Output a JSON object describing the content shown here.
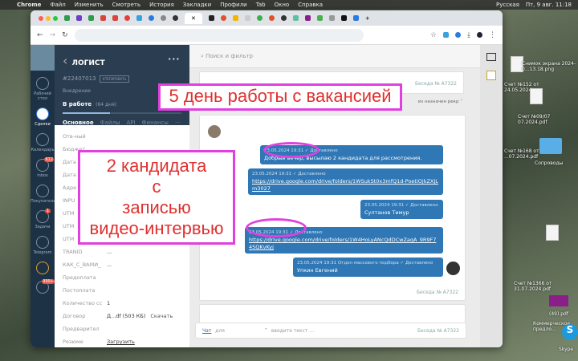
{
  "menubar": {
    "app": "Chrome",
    "items": [
      "Файл",
      "Изменить",
      "Смотреть",
      "История",
      "Закладки",
      "Профили",
      "Tab",
      "Окно",
      "Справка"
    ],
    "input_source": "Русская",
    "datetime": "Пт, 9 авг. 11:18"
  },
  "rail": {
    "items": [
      "Рабочий стол",
      "Сделки",
      "Календарь",
      "inbox",
      "Покупатели",
      "Задачи",
      "Telegram"
    ],
    "inbox_badge": "612",
    "tasks_badge": "1",
    "bell_badge": "999+"
  },
  "lead": {
    "title": "ЛОГИСТ",
    "id": "#22407013",
    "copy": "#ТЕГИРОВАТЬ",
    "stage_label": "Внедрение",
    "stage": "В работе",
    "stage_days": "(64 дня)",
    "progress": 0.4,
    "tabs": [
      "Основное",
      "Файлы",
      "API",
      "Финансы",
      "···"
    ],
    "fields": [
      {
        "k": "Отв-ный",
        "v": ""
      },
      {
        "k": "Бюджет",
        "v": ""
      },
      {
        "k": "Дата",
        "v": ""
      },
      {
        "k": "Дата",
        "v": ""
      },
      {
        "k": "Адре",
        "v": ""
      },
      {
        "k": "INPU",
        "v": ""
      },
      {
        "k": "UTM",
        "v": ""
      },
      {
        "k": "UTM",
        "v": ""
      },
      {
        "k": "UTM",
        "v": ""
      },
      {
        "k": "TRANID",
        "v": "..."
      },
      {
        "k": "КАК_С_ВАМИ_",
        "v": "..."
      },
      {
        "k": "Предоплата",
        "v": ""
      },
      {
        "k": "Постоплата",
        "v": ""
      },
      {
        "k": "Количество сс",
        "v": "1"
      },
      {
        "k": "Договор",
        "v": "Д...df (503 КБ)",
        "action": "Скачать"
      },
      {
        "k": "Предварител",
        "v": ""
      },
      {
        "k": "Резюме",
        "v": "Загрузить"
      }
    ]
  },
  "main": {
    "search_placeholder": "Поиск и фильтр",
    "conversation": "Беседа № A7322",
    "assign": "из назначен рекр",
    "messages": [
      {
        "meta": "23.05.2024 19:31 ✓ Доставлено",
        "text": "Добрый вечер, высылаю 2 кандидата для рассмотрения."
      },
      {
        "meta": "23.05.2024 19:31 ✓ Доставлено",
        "text": "https://drive.google.com/drive/folders/1WSukSt0x3mfQ1d-PoetiOjkZXJLm3027"
      },
      {
        "meta": "23.05.2024 19:31 ✓ Доставлено",
        "text": "Султанов Тимур"
      },
      {
        "meta": "23.05.2024 19:31 ✓ Доставлено",
        "text": "https://drive.google.com/drive/folders/1W4HoLyANcQdDCwZaqA_9R9F74SQKvKyj"
      },
      {
        "meta": "23.05.2024 19:31 Отдел массового подбора ✓ Доставлено",
        "text": "Упкин Евгений"
      }
    ],
    "input": {
      "chat": "Чат",
      "for": "для",
      "placeholder": "введите текст ..."
    }
  },
  "overlays": {
    "top": "5 день работы с вакансией",
    "left": [
      "2 кандидата",
      "с",
      "записью",
      "видео-интервью"
    ]
  },
  "desktop": [
    "Снимок экрана 2024-0...13.18.png",
    "Счет №152 от 24.05.2024",
    "Счет №09/07 07.2024.pdf",
    "Счет №168 от ...07.2024.pdf",
    "Сопроводы",
    "Счет №1366 от 31.07.2024.pdf",
    "Коммерческое предло...",
    "(49).pdf",
    "Skype"
  ],
  "colors": {
    "accent": "#2f77b5",
    "overlay_border": "#e040e0",
    "overlay_text": "#e03030",
    "sidebar": "#1e3246"
  }
}
